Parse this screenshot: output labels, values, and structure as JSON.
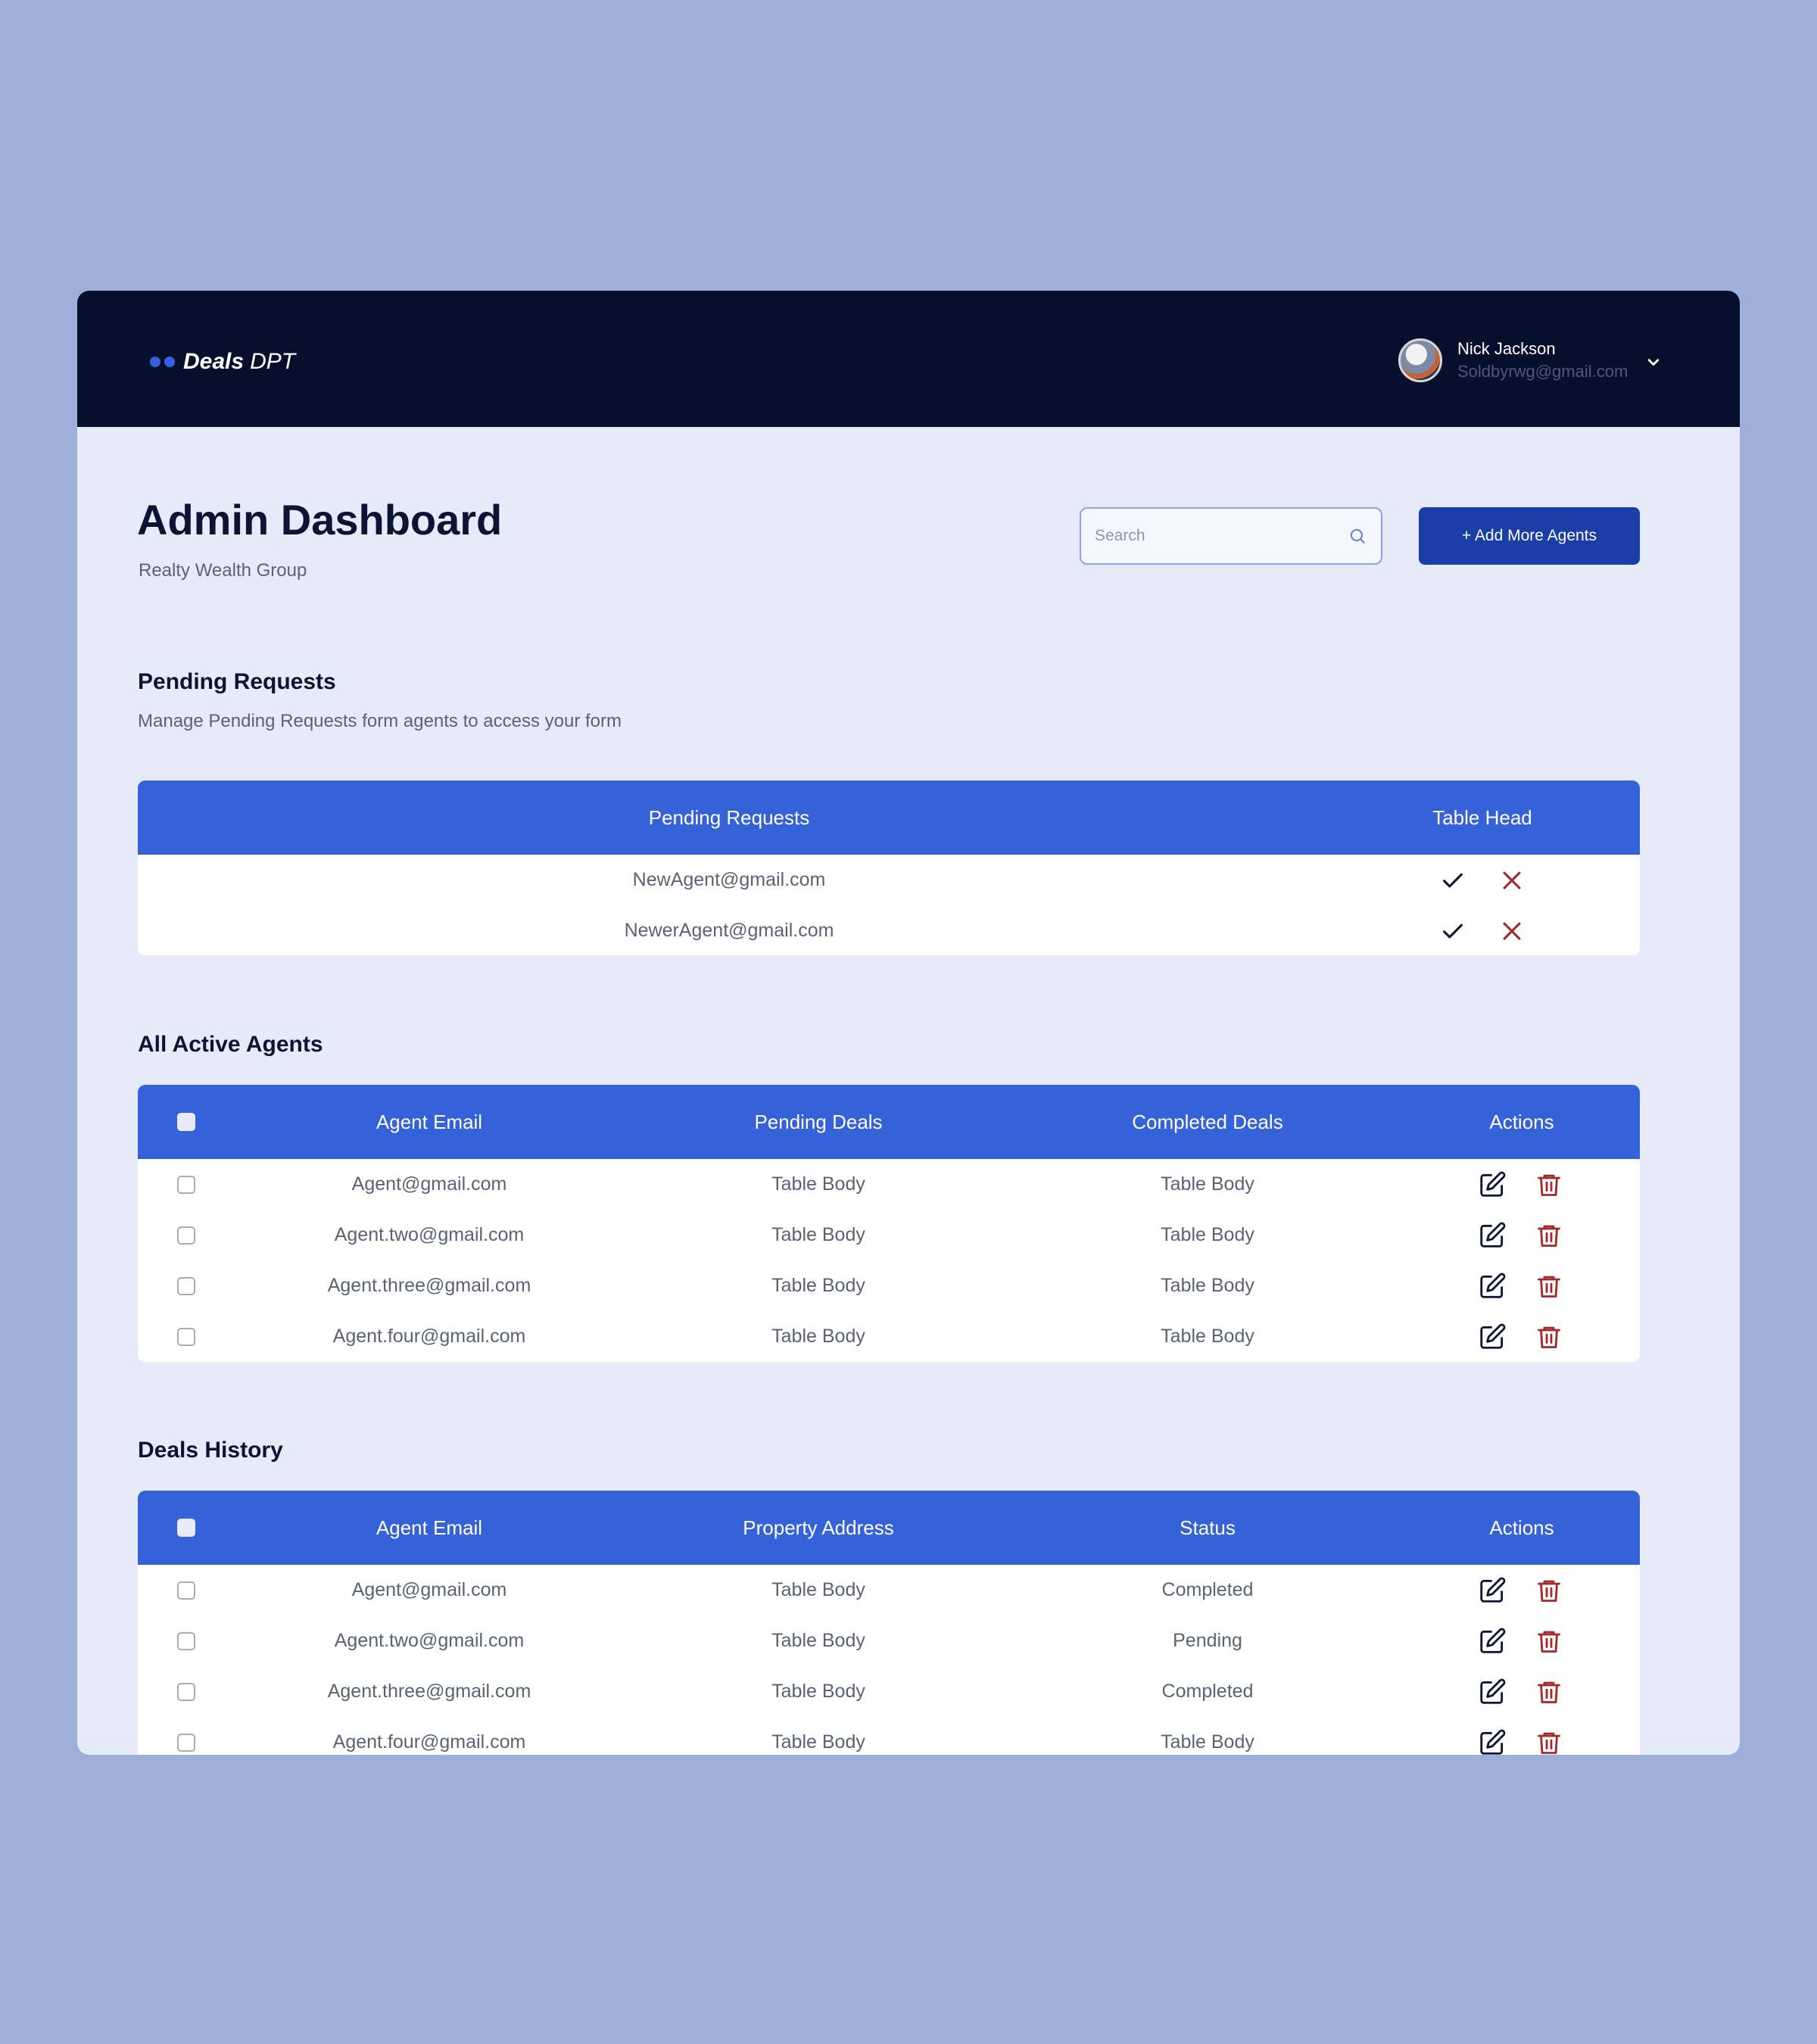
{
  "app": {
    "logo_bold": "Deals",
    "logo_light": "DPT"
  },
  "user": {
    "name": "Nick Jackson",
    "email": "Soldbyrwg@gmail.com"
  },
  "header": {
    "title": "Admin Dashboard",
    "subtitle": "Realty Wealth Group",
    "search_placeholder": "Search",
    "add_button": "+ Add More Agents"
  },
  "pending": {
    "title": "Pending Requests",
    "description": "Manage Pending Requests form agents to access your form",
    "columns": [
      "Pending Requests",
      "Table Head"
    ],
    "rows": [
      {
        "email": "NewAgent@gmail.com"
      },
      {
        "email": "NewerAgent@gmail.com"
      }
    ]
  },
  "agents": {
    "title": "All Active Agents",
    "columns": [
      "Agent Email",
      "Pending Deals",
      "Completed Deals",
      "Actions"
    ],
    "rows": [
      {
        "email": "Agent@gmail.com",
        "pending": "Table Body",
        "completed": "Table Body"
      },
      {
        "email": "Agent.two@gmail.com",
        "pending": "Table Body",
        "completed": "Table Body"
      },
      {
        "email": "Agent.three@gmail.com",
        "pending": "Table Body",
        "completed": "Table Body"
      },
      {
        "email": "Agent.four@gmail.com",
        "pending": "Table Body",
        "completed": "Table Body"
      }
    ]
  },
  "deals": {
    "title": "Deals History",
    "columns": [
      "Agent Email",
      "Property Address",
      "Status",
      "Actions"
    ],
    "rows": [
      {
        "email": "Agent@gmail.com",
        "address": "Table Body",
        "status": "Completed"
      },
      {
        "email": "Agent.two@gmail.com",
        "address": "Table Body",
        "status": "Pending"
      },
      {
        "email": "Agent.three@gmail.com",
        "address": "Table Body",
        "status": "Completed"
      },
      {
        "email": "Agent.four@gmail.com",
        "address": "Table Body",
        "status": "Table Body"
      }
    ]
  },
  "icons": {
    "approve": "check-icon",
    "reject": "close-icon",
    "edit": "edit-icon",
    "delete": "trash-icon",
    "search": "search-icon",
    "dropdown": "chevron-down-icon"
  },
  "colors": {
    "page_background": "#9eafdb",
    "topbar": "#060f2b",
    "content_background": "#e6ebfa",
    "table_header": "#3561d9",
    "primary_button": "#1a3ea5",
    "reject_red": "#a32a2a",
    "delete_red": "#a32a2a"
  }
}
